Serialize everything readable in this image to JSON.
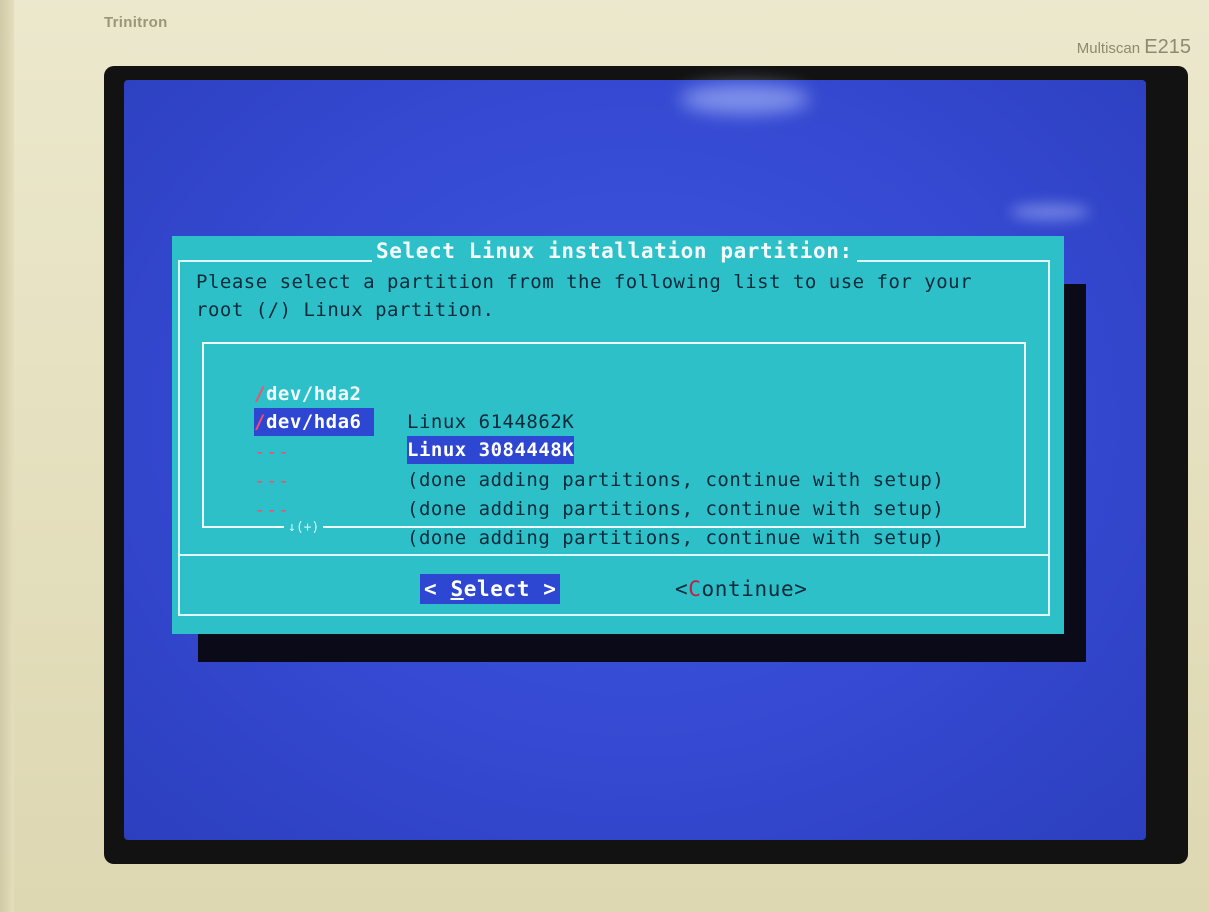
{
  "monitor": {
    "brand": "Trinitron",
    "model_prefix": "Multiscan",
    "model_number": "E215"
  },
  "dialog": {
    "title": "Select Linux installation partition:",
    "prompt_line_1": "Please select a partition from the following list to use for your",
    "prompt_line_2": "root (/) Linux partition.",
    "partitions": [
      {
        "device": "dev/hda2",
        "description": "Linux 6144862K",
        "selected": false
      },
      {
        "device": "dev/hda6",
        "description": "Linux 3084448K",
        "selected": true
      },
      {
        "device": "---",
        "description": "(done adding partitions, continue with setup)",
        "selected": false
      },
      {
        "device": "---",
        "description": "(done adding partitions, continue with setup)",
        "selected": false
      },
      {
        "device": "---",
        "description": "(done adding partitions, continue with setup)",
        "selected": false
      }
    ],
    "device_prefix": "/",
    "scroll_indicator": "↓(+)",
    "buttons": {
      "select": {
        "left": "< ",
        "hotkey": "S",
        "rest": "elect",
        "right": " >"
      },
      "continue": {
        "left": "<",
        "hotkey": "C",
        "rest": "ontinue",
        "right": ">"
      }
    }
  },
  "colors": {
    "screen_background": "#3549d2",
    "dialog_background": "#2dc0c8",
    "highlight": "#2d47d3",
    "hotkey_red": "#ff4a6a"
  }
}
